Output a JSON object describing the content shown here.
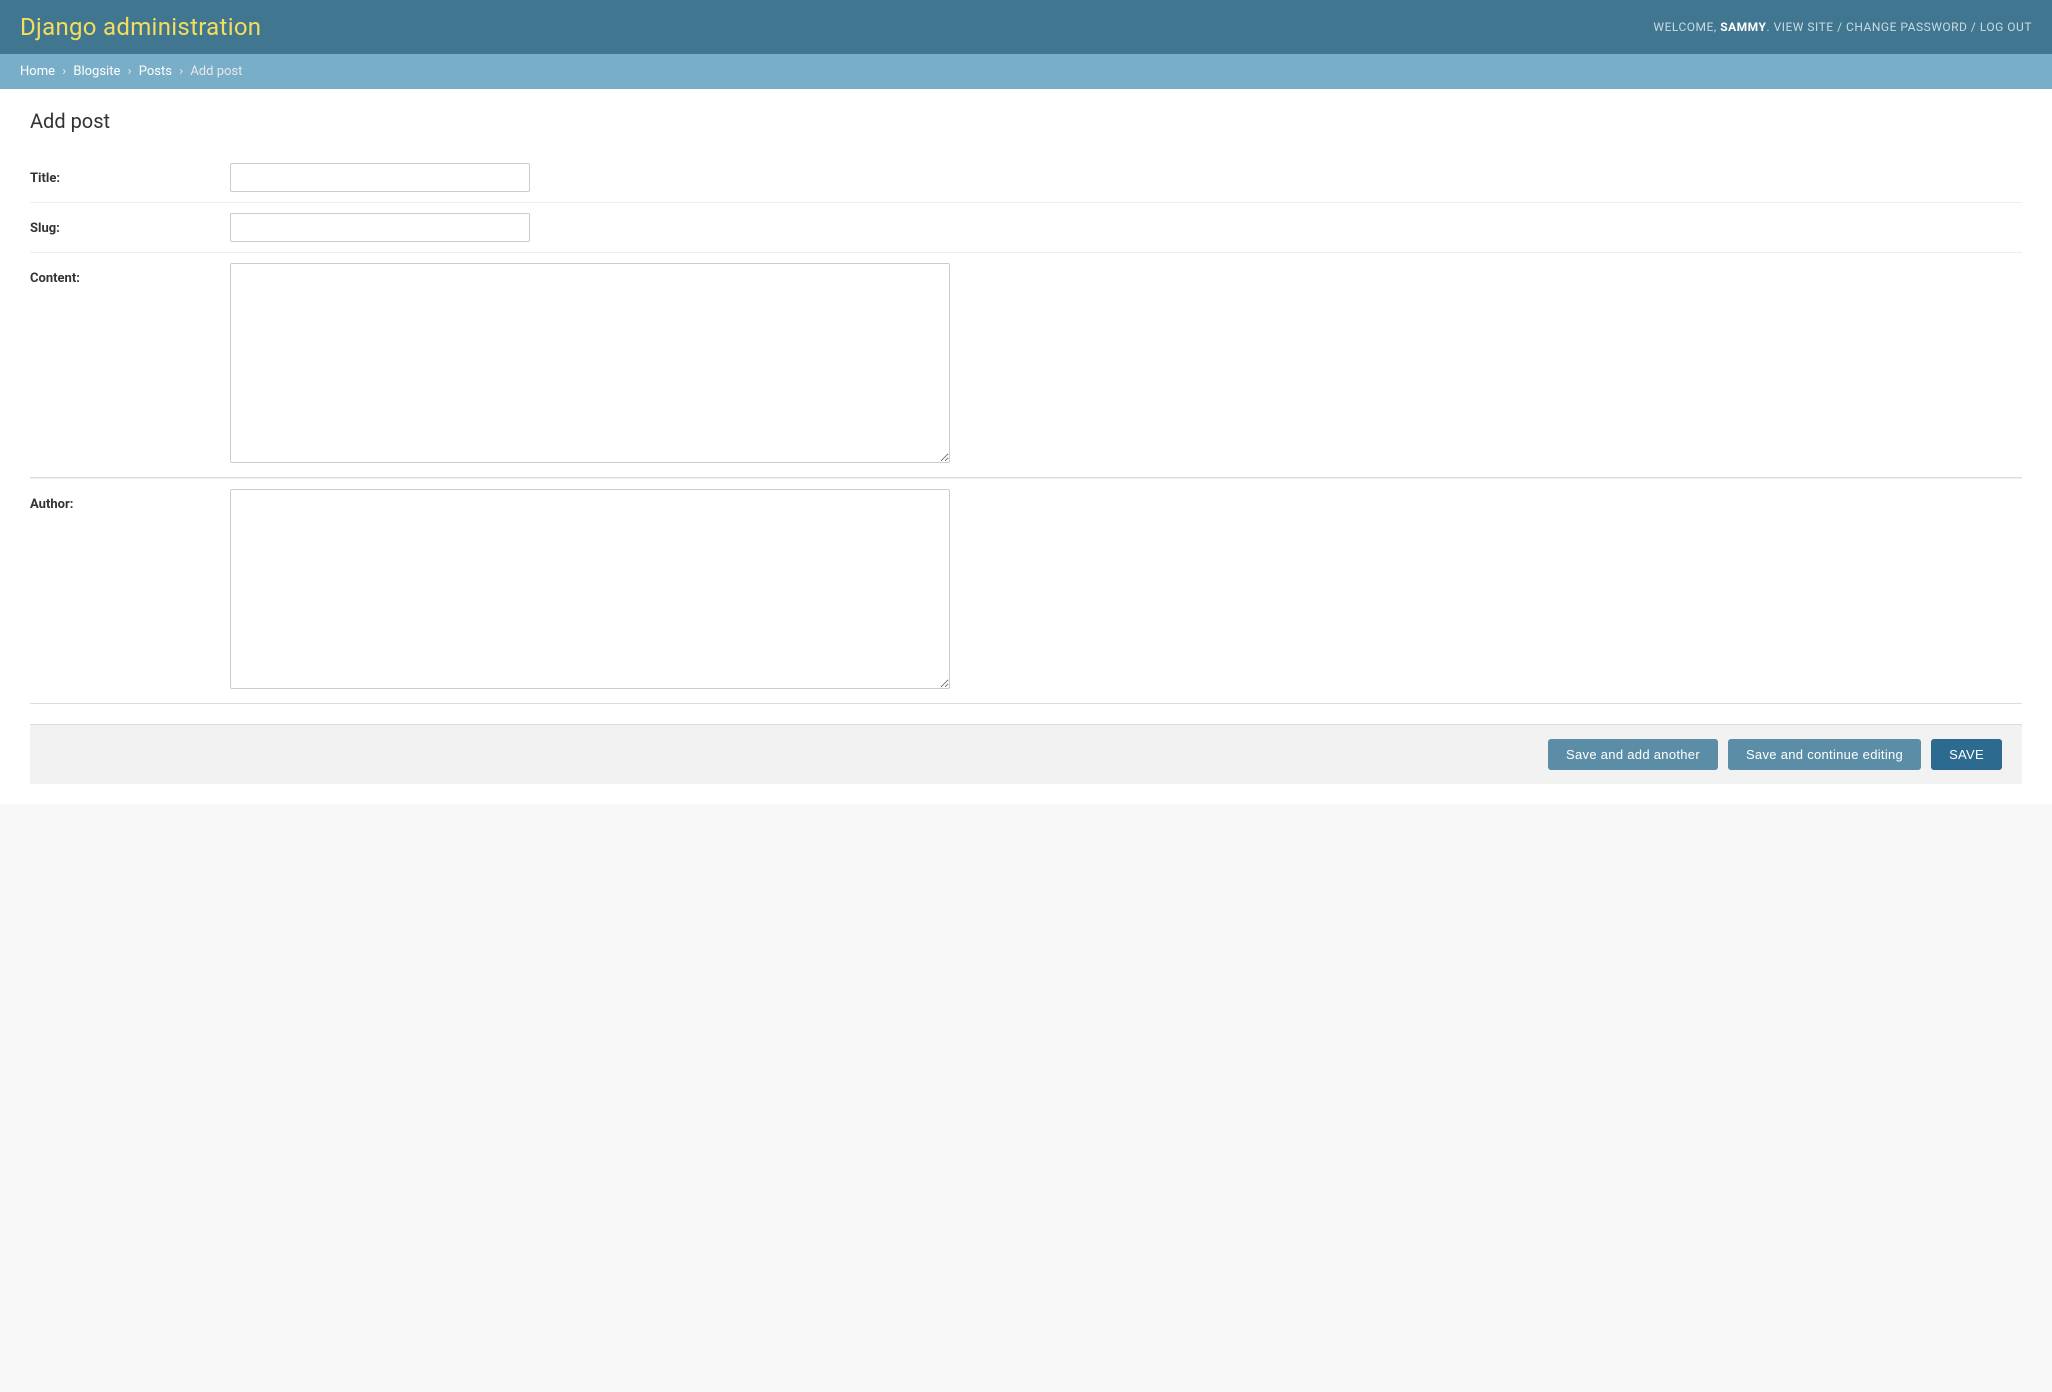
{
  "header": {
    "title": "Django administration",
    "welcome_text": "WELCOME,",
    "username": "SAMMY",
    "nav": {
      "view_site": "VIEW SITE",
      "change_password": "CHANGE PASSWORD",
      "log_out": "LOG OUT",
      "separator": "/"
    }
  },
  "breadcrumbs": {
    "home": "Home",
    "app": "Blogsite",
    "model": "Posts",
    "current": "Add post",
    "separator": "›"
  },
  "page": {
    "title": "Add post"
  },
  "form": {
    "fields": [
      {
        "label": "Title:",
        "type": "text",
        "name": "title",
        "value": "",
        "placeholder": ""
      },
      {
        "label": "Slug:",
        "type": "text",
        "name": "slug",
        "value": "",
        "placeholder": ""
      },
      {
        "label": "Content:",
        "type": "textarea",
        "name": "content",
        "value": "",
        "placeholder": ""
      },
      {
        "label": "Author:",
        "type": "textarea",
        "name": "author",
        "value": "",
        "placeholder": ""
      }
    ]
  },
  "submit_row": {
    "save_add_another": "Save and add another",
    "save_continue_editing": "Save and continue editing",
    "save": "SAVE"
  }
}
